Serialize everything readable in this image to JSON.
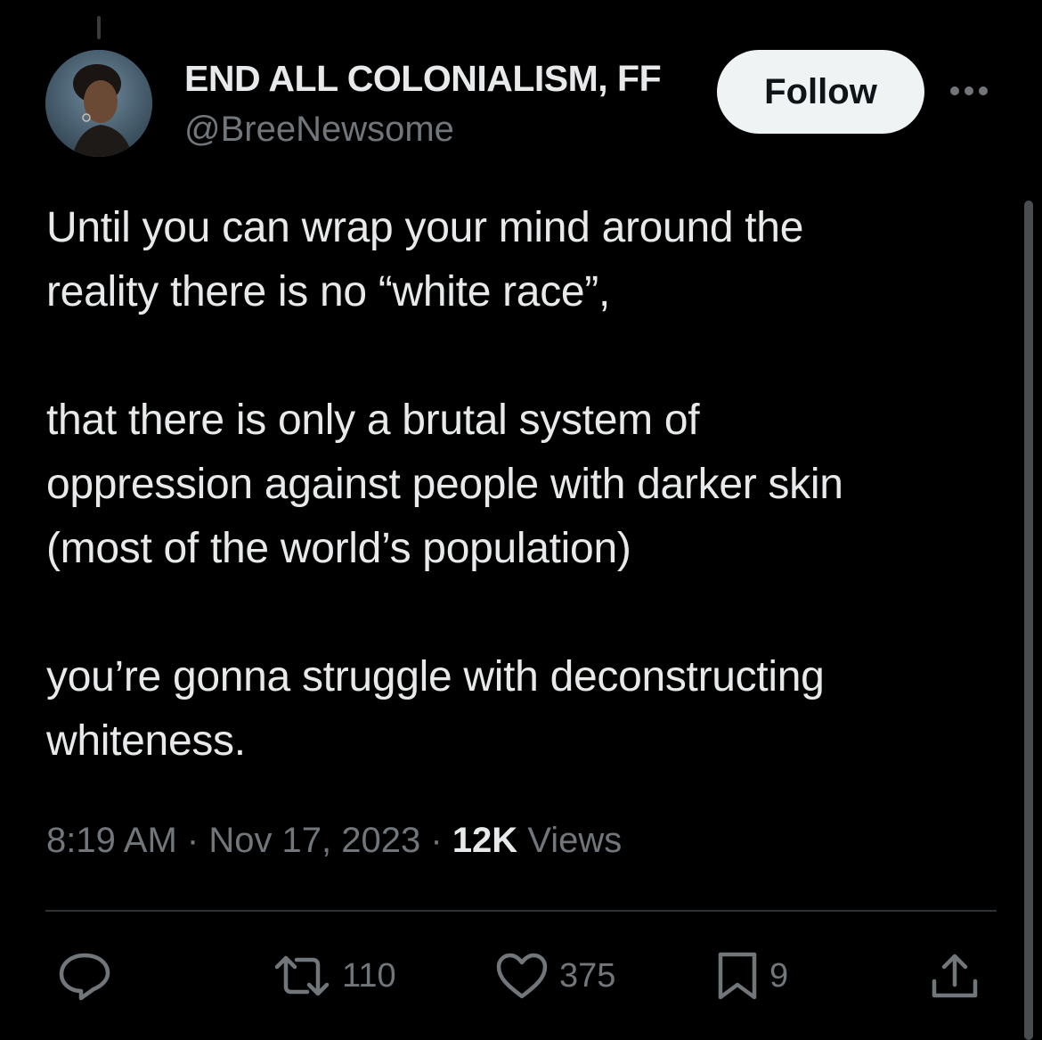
{
  "author": {
    "display_name": "END ALL COLONIALISM, FF",
    "handle": "@BreeNewsome",
    "follow_label": "Follow"
  },
  "tweet": {
    "text": "Until you can wrap your mind around the\nreality there is no “white race”,\n\nthat there is only a brutal system of\noppression against people with darker skin\n(most of the world’s population)\n\nyou’re gonna struggle with deconstructing\nwhiteness."
  },
  "meta": {
    "time": "8:19 AM",
    "separator": " · ",
    "date": "Nov 17, 2023",
    "views_count": "12K",
    "views_label": " Views"
  },
  "actions": {
    "reply_count": "",
    "retweet_count": "110",
    "like_count": "375",
    "bookmark_count": "9"
  },
  "icons": {
    "reply": "reply-icon",
    "retweet": "retweet-icon",
    "like": "heart-icon",
    "bookmark": "bookmark-icon",
    "share": "share-icon",
    "more": "more-icon"
  },
  "colors": {
    "background": "#000000",
    "text_primary": "#e7e9ea",
    "text_secondary": "#71767b",
    "follow_bg": "#eff3f4",
    "divider": "#2f3336"
  }
}
